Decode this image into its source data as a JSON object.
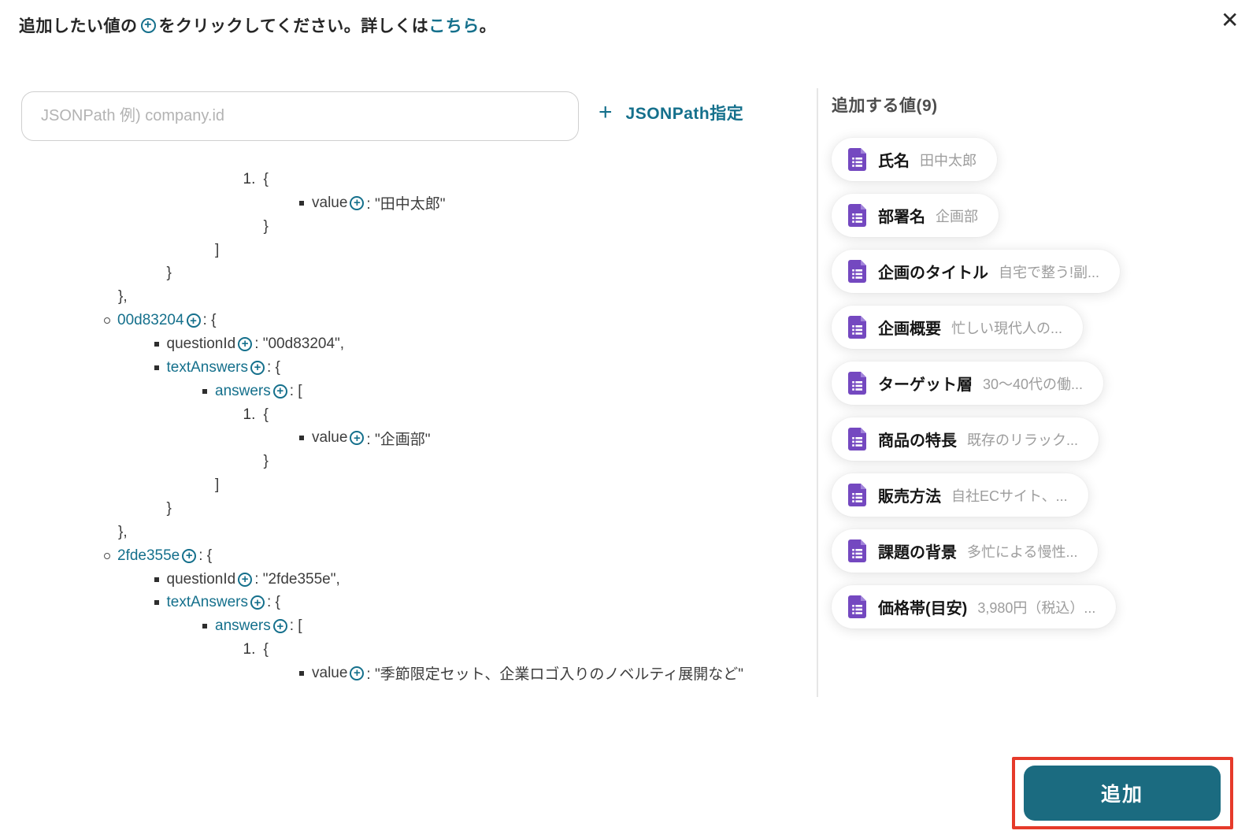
{
  "header": {
    "text_before": "追加したい値の",
    "plus_icon": "+",
    "text_after": "をクリックしてください。詳しくは",
    "link_label": "こちら",
    "text_end": "。",
    "close_icon": "✕"
  },
  "jsonpath": {
    "placeholder": "JSONPath 例) company.id",
    "button_plus": "+",
    "button_label": "JSONPath指定"
  },
  "tree": {
    "rows": [
      {
        "depth": 3,
        "bullet": "num",
        "num": "1.",
        "text": "{"
      },
      {
        "depth": 4,
        "bullet": "square",
        "key": "value",
        "key_link": false,
        "plus": true,
        "text": ": \"田中太郎\""
      },
      {
        "depth": 3,
        "text": "}"
      },
      {
        "depth": 2,
        "text": "]"
      },
      {
        "depth": 1,
        "text": "}"
      },
      {
        "depth": 0,
        "text": "},"
      },
      {
        "depth": 0,
        "bullet": "circle",
        "key": "00d83204",
        "key_link": true,
        "plus": true,
        "text": ": {"
      },
      {
        "depth": 1,
        "bullet": "square",
        "key": "questionId",
        "key_link": false,
        "plus": true,
        "text": ": \"00d83204\","
      },
      {
        "depth": 1,
        "bullet": "square",
        "key": "textAnswers",
        "key_link": true,
        "plus": true,
        "text": ": {"
      },
      {
        "depth": 2,
        "bullet": "square",
        "key": "answers",
        "key_link": true,
        "plus": true,
        "text": ": ["
      },
      {
        "depth": 3,
        "bullet": "num",
        "num": "1.",
        "text": "{"
      },
      {
        "depth": 4,
        "bullet": "square",
        "key": "value",
        "key_link": false,
        "plus": true,
        "text": ": \"企画部\""
      },
      {
        "depth": 3,
        "text": "}"
      },
      {
        "depth": 2,
        "text": "]"
      },
      {
        "depth": 1,
        "text": "}"
      },
      {
        "depth": 0,
        "text": "},"
      },
      {
        "depth": 0,
        "bullet": "circle",
        "key": "2fde355e",
        "key_link": true,
        "plus": true,
        "text": ": {"
      },
      {
        "depth": 1,
        "bullet": "square",
        "key": "questionId",
        "key_link": false,
        "plus": true,
        "text": ": \"2fde355e\","
      },
      {
        "depth": 1,
        "bullet": "square",
        "key": "textAnswers",
        "key_link": true,
        "plus": true,
        "text": ": {"
      },
      {
        "depth": 2,
        "bullet": "square",
        "key": "answers",
        "key_link": true,
        "plus": true,
        "text": ": ["
      },
      {
        "depth": 3,
        "bullet": "num",
        "num": "1.",
        "text": "{"
      },
      {
        "depth": 4,
        "bullet": "square",
        "key": "value",
        "key_link": false,
        "plus": true,
        "text": ": \"季節限定セット、企業ロゴ入りのノベルティ展開など\""
      }
    ]
  },
  "sidebar": {
    "title": "追加する値(9)",
    "chip_icon": "form-document-icon",
    "chips": [
      {
        "label": "氏名",
        "value": "田中太郎"
      },
      {
        "label": "部署名",
        "value": "企画部"
      },
      {
        "label": "企画のタイトル",
        "value": "自宅で整う!副..."
      },
      {
        "label": "企画概要",
        "value": "忙しい現代人の..."
      },
      {
        "label": "ターゲット層",
        "value": "30〜40代の働..."
      },
      {
        "label": "商品の特長",
        "value": "既存のリラック..."
      },
      {
        "label": "販売方法",
        "value": "自社ECサイト、..."
      },
      {
        "label": "課題の背景",
        "value": "多忙による慢性..."
      },
      {
        "label": "価格帯(目安)",
        "value": "3,980円（税込）..."
      }
    ]
  },
  "footer": {
    "add_button": "追加"
  },
  "colors": {
    "teal": "#15708c",
    "teal_button": "#1b6b80",
    "annotation_red": "#e63a2a",
    "chip_icon_purple": "#7448c0"
  }
}
